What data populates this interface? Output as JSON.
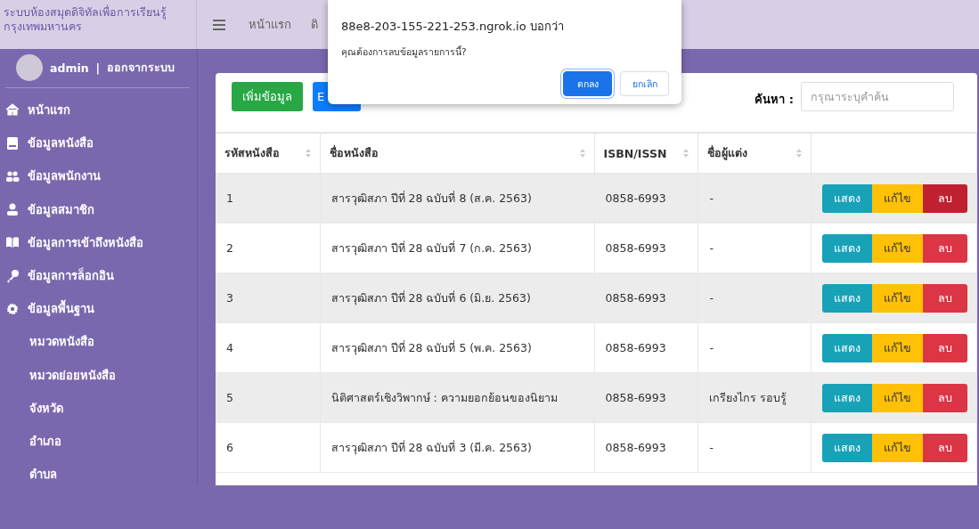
{
  "header": {
    "title_lines": [
      "ระบบห้องสมุดดิจิทัลเพื่อการเรียนรู้",
      "กรุงเทพมหานคร"
    ],
    "nav": [
      {
        "label": "หน้าแรก"
      },
      {
        "label": "ดิ"
      }
    ]
  },
  "user": {
    "name": "admin",
    "separator": "|",
    "logout": "ออกจากระบบ"
  },
  "sidebar": {
    "items": [
      {
        "label": "หน้าแรก",
        "kind": "main"
      },
      {
        "label": "ข้อมูลหนังสือ",
        "kind": "main"
      },
      {
        "label": "ข้อมูลพนักงาน",
        "kind": "main"
      },
      {
        "label": "ข้อมูลสมาชิก",
        "kind": "main"
      },
      {
        "label": "ข้อมูลการเข้าถึงหนังสือ",
        "kind": "main"
      },
      {
        "label": "ข้อมูลการล็อกอิน",
        "kind": "main"
      },
      {
        "label": "ข้อมูลพื้นฐาน",
        "kind": "main"
      },
      {
        "label": "หมวดหนังสือ",
        "kind": "sub"
      },
      {
        "label": "หมวดย่อยหนังสือ",
        "kind": "sub"
      },
      {
        "label": "จังหวัด",
        "kind": "sub"
      },
      {
        "label": "อำเภอ",
        "kind": "sub"
      },
      {
        "label": "ตำบล",
        "kind": "sub"
      }
    ]
  },
  "toolbar": {
    "add_button": "เพิ่มข้อมูล",
    "export_button": "E",
    "search_label": "ค้นหา :",
    "search": {
      "placeholder": "กรุณาระบุคำค้น"
    }
  },
  "table": {
    "columns": [
      {
        "label": "รหัสหนังสือ",
        "sortable": true
      },
      {
        "label": "ชื่อหนังสือ",
        "sortable": true
      },
      {
        "label": "ISBN/ISSN",
        "sortable": true
      },
      {
        "label": "ชื่อผู้แต่ง",
        "sortable": true
      },
      {
        "sortable": false
      }
    ],
    "rows": [
      {
        "cells": [
          "1",
          "สารวุฒิสภา ปีที่ 28 ฉบับที่ 8 (ส.ค. 2563)",
          "0858-6993",
          "-"
        ],
        "actions": [
          {
            "kind": "view",
            "label": "แสดง"
          },
          {
            "kind": "edit",
            "label": "แก้ไข"
          },
          {
            "kind": "delete",
            "label": "ลบ",
            "hovered": true
          }
        ]
      },
      {
        "cells": [
          "2",
          "สารวุฒิสภา ปีที่ 28 ฉบับที่ 7 (ก.ค. 2563)",
          "0858-6993",
          "-"
        ],
        "actions": [
          {
            "kind": "view",
            "label": "แสดง"
          },
          {
            "kind": "edit",
            "label": "แก้ไข"
          },
          {
            "kind": "delete",
            "label": "ลบ",
            "hovered": false
          }
        ]
      },
      {
        "cells": [
          "3",
          "สารวุฒิสภา ปีที่ 28 ฉบับที่ 6 (มิ.ย. 2563)",
          "0858-6993",
          "-"
        ],
        "actions": [
          {
            "kind": "view",
            "label": "แสดง"
          },
          {
            "kind": "edit",
            "label": "แก้ไข"
          },
          {
            "kind": "delete",
            "label": "ลบ",
            "hovered": false
          }
        ]
      },
      {
        "cells": [
          "4",
          "สารวุฒิสภา ปีที่ 28 ฉบับที่ 5 (พ.ค. 2563)",
          "0858-6993",
          "-"
        ],
        "actions": [
          {
            "kind": "view",
            "label": "แสดง"
          },
          {
            "kind": "edit",
            "label": "แก้ไข"
          },
          {
            "kind": "delete",
            "label": "ลบ",
            "hovered": false
          }
        ]
      },
      {
        "cells": [
          "5",
          "นิติศาสตร์เชิงวิพากษ์ : ความยอกย้อนของนิยาม",
          "0858-6993",
          "เกรียงไกร รอบรู้"
        ],
        "actions": [
          {
            "kind": "view",
            "label": "แสดง"
          },
          {
            "kind": "edit",
            "label": "แก้ไข"
          },
          {
            "kind": "delete",
            "label": "ลบ",
            "hovered": false
          }
        ]
      },
      {
        "cells": [
          "6",
          "สารวุฒิสภา ปีที่ 28 ฉบับที่ 3 (มี.ค. 2563)",
          "0858-6993",
          "-"
        ],
        "actions": [
          {
            "kind": "view",
            "label": "แสดง"
          },
          {
            "kind": "edit",
            "label": "แก้ไข"
          },
          {
            "kind": "delete",
            "label": "ลบ",
            "hovered": false
          }
        ]
      }
    ]
  },
  "dialog": {
    "origin": "88e8-203-155-221-253.ngrok.io บอกว่า",
    "message": "คุณต้องการลบข้อมูลรายการนี้?",
    "buttons": [
      {
        "label": "ตกลง",
        "kind": "primary",
        "focused": true
      },
      {
        "label": "ยกเลิก",
        "kind": "secondary",
        "focused": false
      }
    ]
  }
}
